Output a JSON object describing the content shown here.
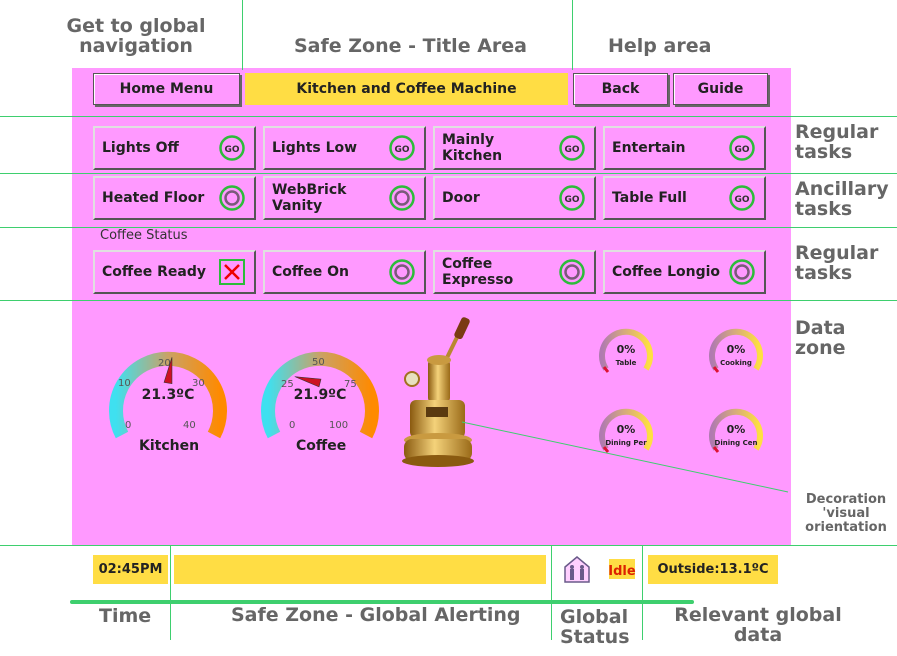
{
  "annotations": {
    "global_nav": "Get to global navigation",
    "title_area": "Safe Zone - Title Area",
    "help_area": "Help area",
    "regular_tasks_1": "Regular tasks",
    "ancillary_tasks": "Ancillary tasks",
    "regular_tasks_2": "Regular tasks",
    "data_zone": "Data zone",
    "decoration": "Decoration 'visual orientation",
    "time": "Time",
    "global_alerting": "Safe Zone - Global Alerting",
    "global_status": "Global Status",
    "relevant_data": "Relevant global data"
  },
  "header": {
    "home_label": "Home Menu",
    "title": "Kitchen and Coffee Machine",
    "back_label": "Back",
    "guide_label": "Guide"
  },
  "tasks": [
    {
      "label": "Lights Off",
      "icon": "go-icon"
    },
    {
      "label": "Lights Low",
      "icon": "go-icon"
    },
    {
      "label": "Mainly Kitchen",
      "icon": "go-icon"
    },
    {
      "label": "Entertain",
      "icon": "go-icon"
    },
    {
      "label": "Heated Floor",
      "icon": "ring-icon"
    },
    {
      "label": "WebBrick Vanity",
      "icon": "ring-icon"
    },
    {
      "label": "Door",
      "icon": "go-icon"
    },
    {
      "label": "Table Full",
      "icon": "go-icon"
    },
    {
      "label": "Coffee Ready",
      "icon": "cross-icon"
    },
    {
      "label": "Coffee On",
      "icon": "ring-icon"
    },
    {
      "label": "Coffee Expresso",
      "icon": "ring-icon"
    },
    {
      "label": "Coffee Longio",
      "icon": "ring-icon"
    }
  ],
  "coffee_status_label": "Coffee Status",
  "go_text": "GO",
  "gauges": {
    "kitchen": {
      "label": "Kitchen",
      "reading": "21.3ºC",
      "value": 21.3,
      "min": 0,
      "max": 40,
      "ticks": [
        "0",
        "10",
        "20",
        "30",
        "40"
      ]
    },
    "coffee": {
      "label": "Coffee",
      "reading": "21.9ºC",
      "value": 21.9,
      "min": 0,
      "max": 100,
      "ticks": [
        "0",
        "25",
        "50",
        "75",
        "100"
      ]
    }
  },
  "dials": [
    {
      "percent": "0%",
      "name": "Table",
      "value": 0
    },
    {
      "percent": "0%",
      "name": "Cooking",
      "value": 0
    },
    {
      "percent": "0%",
      "name": "Dining Per",
      "value": 0
    },
    {
      "percent": "0%",
      "name": "Dining Cen",
      "value": 0
    }
  ],
  "footer": {
    "time": "02:45PM",
    "alert_text": "",
    "status_badge": "Idle",
    "outside": "Outside:13.1ºC"
  },
  "colors": {
    "panel": "#ff99ff",
    "accent_yellow": "#ffdd44",
    "guide_green": "#3ecf6e",
    "icon_green": "#2dbb3a"
  }
}
